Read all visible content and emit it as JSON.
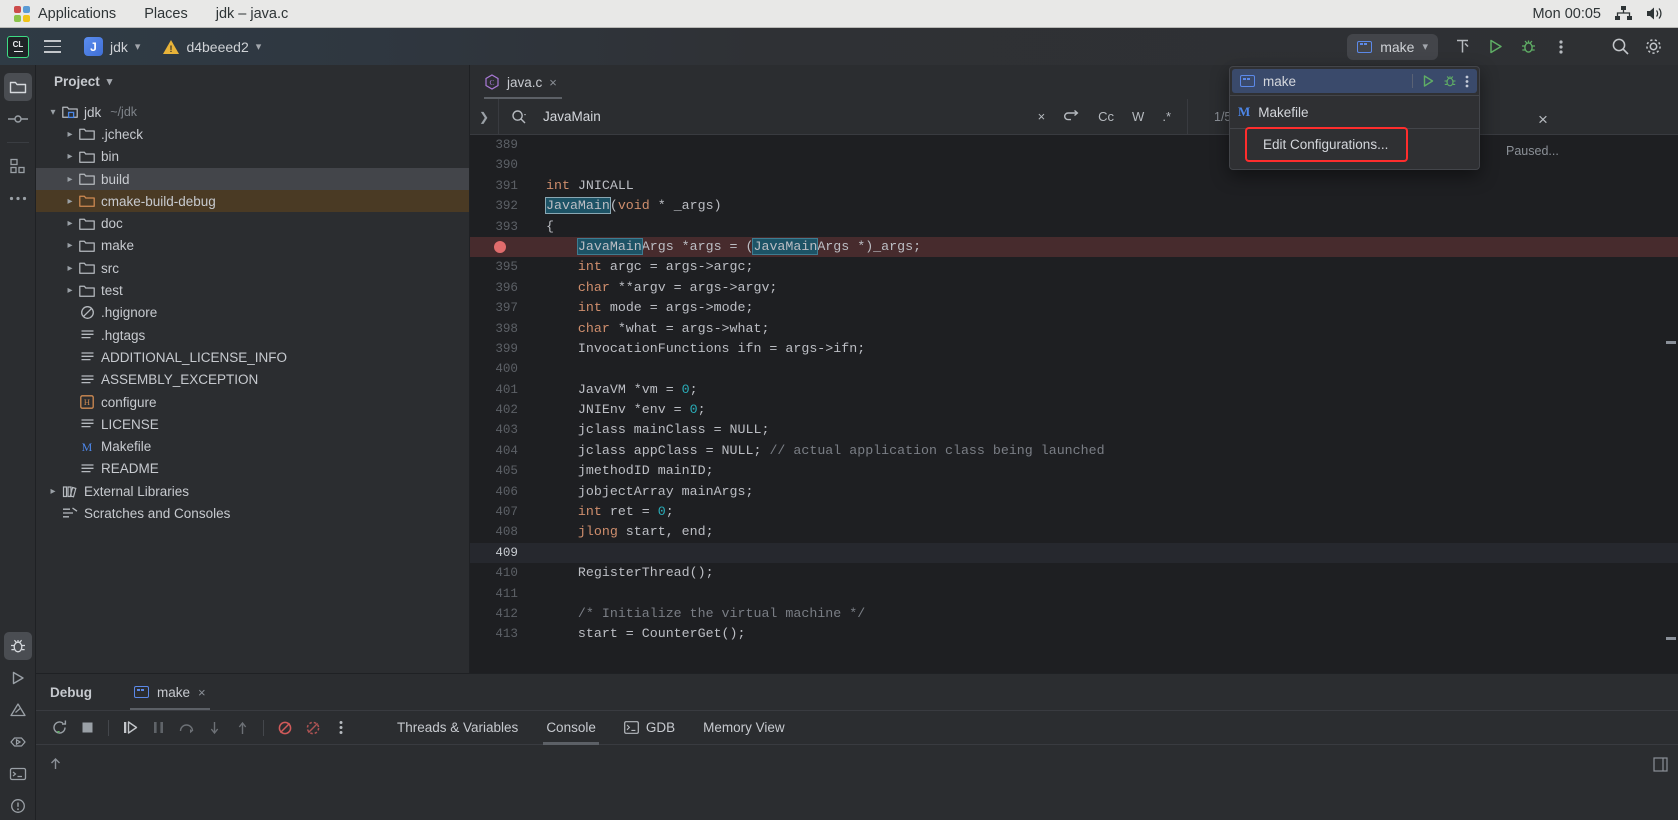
{
  "desktop": {
    "menu": [
      "Applications",
      "Places"
    ],
    "window_title": "jdk – java.c",
    "clock": "Mon 00:05",
    "tray": [
      "network-icon",
      "volume-icon"
    ]
  },
  "toolbar": {
    "app_badge": "CL",
    "menu_icon": "hamburger-icon",
    "project_name": "jdk",
    "project_initial": "J",
    "branch_name": "d4beeed2",
    "run_config": "make",
    "buttons": [
      "build-icon",
      "run-icon",
      "debug-icon",
      "more-icon"
    ],
    "search_icon": "search-icon",
    "settings_icon": "gear-icon"
  },
  "rail": {
    "top": [
      "project-folder-icon",
      "commit-icon",
      "structure-icon",
      "more-tool-windows-icon"
    ],
    "bottom": [
      "debug-icon",
      "run-icon",
      "problems-icon",
      "services-icon",
      "terminal-icon",
      "notifications-icon"
    ]
  },
  "project": {
    "title": "Project",
    "tree": [
      {
        "label": "jdk",
        "note": "~/jdk",
        "indent": 0,
        "twisty": "down",
        "icon": "project-folder-icon",
        "state": "none"
      },
      {
        "label": ".jcheck",
        "note": "",
        "indent": 1,
        "twisty": "right",
        "icon": "folder-icon",
        "state": "none"
      },
      {
        "label": "bin",
        "note": "",
        "indent": 1,
        "twisty": "right",
        "icon": "folder-icon",
        "state": "none"
      },
      {
        "label": "build",
        "note": "",
        "indent": 1,
        "twisty": "right",
        "icon": "folder-icon",
        "state": "selected"
      },
      {
        "label": "cmake-build-debug",
        "note": "",
        "indent": 1,
        "twisty": "right",
        "icon": "folder-orange-icon",
        "state": "highlight"
      },
      {
        "label": "doc",
        "note": "",
        "indent": 1,
        "twisty": "right",
        "icon": "folder-icon",
        "state": "none"
      },
      {
        "label": "make",
        "note": "",
        "indent": 1,
        "twisty": "right",
        "icon": "folder-icon",
        "state": "none"
      },
      {
        "label": "src",
        "note": "",
        "indent": 1,
        "twisty": "right",
        "icon": "folder-icon",
        "state": "none"
      },
      {
        "label": "test",
        "note": "",
        "indent": 1,
        "twisty": "right",
        "icon": "folder-icon",
        "state": "none"
      },
      {
        "label": ".hgignore",
        "note": "",
        "indent": 1,
        "twisty": "",
        "icon": "ignore-file-icon",
        "state": "none"
      },
      {
        "label": ".hgtags",
        "note": "",
        "indent": 1,
        "twisty": "",
        "icon": "text-file-icon",
        "state": "none"
      },
      {
        "label": "ADDITIONAL_LICENSE_INFO",
        "note": "",
        "indent": 1,
        "twisty": "",
        "icon": "text-file-icon",
        "state": "none"
      },
      {
        "label": "ASSEMBLY_EXCEPTION",
        "note": "",
        "indent": 1,
        "twisty": "",
        "icon": "text-file-icon",
        "state": "none"
      },
      {
        "label": "configure",
        "note": "",
        "indent": 1,
        "twisty": "",
        "icon": "shell-file-icon",
        "state": "none"
      },
      {
        "label": "LICENSE",
        "note": "",
        "indent": 1,
        "twisty": "",
        "icon": "text-file-icon",
        "state": "none"
      },
      {
        "label": "Makefile",
        "note": "",
        "indent": 1,
        "twisty": "",
        "icon": "makefile-icon",
        "state": "none"
      },
      {
        "label": "README",
        "note": "",
        "indent": 1,
        "twisty": "",
        "icon": "text-file-icon",
        "state": "none"
      },
      {
        "label": "External Libraries",
        "note": "",
        "indent": 0,
        "twisty": "right",
        "icon": "library-icon",
        "state": "none"
      },
      {
        "label": "Scratches and Consoles",
        "note": "",
        "indent": 0,
        "twisty": "",
        "icon": "scratches-icon",
        "state": "none"
      }
    ]
  },
  "editor": {
    "tab": {
      "label": "java.c",
      "icon": "c-file-icon",
      "close": "×"
    },
    "find": {
      "value": "JavaMain",
      "clear": "×",
      "toggles": [
        "regex-replace-icon",
        "Cc",
        "W",
        ".*"
      ],
      "count": "1/5",
      "prev": "↑",
      "next": "↓",
      "filter_icon": "filter-icon",
      "more_icon": "more-icon"
    },
    "lines": [
      {
        "n": "389",
        "text": "",
        "state": "normal"
      },
      {
        "n": "390",
        "text": "",
        "state": "normal"
      },
      {
        "n": "391",
        "text": "int JNICALL",
        "state": "normal"
      },
      {
        "n": "392",
        "text": "JavaMain(void * _args)",
        "state": "normal"
      },
      {
        "n": "393",
        "text": "{",
        "state": "normal"
      },
      {
        "n": "394",
        "text": "    JavaMainArgs *args = (JavaMainArgs *)_args;",
        "state": "breakpoint"
      },
      {
        "n": "395",
        "text": "    int argc = args->argc;",
        "state": "normal"
      },
      {
        "n": "396",
        "text": "    char **argv = args->argv;",
        "state": "normal"
      },
      {
        "n": "397",
        "text": "    int mode = args->mode;",
        "state": "normal"
      },
      {
        "n": "398",
        "text": "    char *what = args->what;",
        "state": "normal"
      },
      {
        "n": "399",
        "text": "    InvocationFunctions ifn = args->ifn;",
        "state": "normal"
      },
      {
        "n": "400",
        "text": "",
        "state": "normal"
      },
      {
        "n": "401",
        "text": "    JavaVM *vm = 0;",
        "state": "normal"
      },
      {
        "n": "402",
        "text": "    JNIEnv *env = 0;",
        "state": "normal"
      },
      {
        "n": "403",
        "text": "    jclass mainClass = NULL;",
        "state": "normal"
      },
      {
        "n": "404",
        "text": "    jclass appClass = NULL; // actual application class being launched",
        "state": "normal"
      },
      {
        "n": "405",
        "text": "    jmethodID mainID;",
        "state": "normal"
      },
      {
        "n": "406",
        "text": "    jobjectArray mainArgs;",
        "state": "normal"
      },
      {
        "n": "407",
        "text": "    int ret = 0;",
        "state": "normal"
      },
      {
        "n": "408",
        "text": "    jlong start, end;",
        "state": "normal"
      },
      {
        "n": "409",
        "text": "",
        "state": "caret"
      },
      {
        "n": "410",
        "text": "    RegisterThread();",
        "state": "normal"
      },
      {
        "n": "411",
        "text": "",
        "state": "normal"
      },
      {
        "n": "412",
        "text": "    /* Initialize the virtual machine */",
        "state": "normal"
      },
      {
        "n": "413",
        "text": "    start = CounterGet();",
        "state": "normal"
      }
    ]
  },
  "run_popup": {
    "items": [
      {
        "label": "make",
        "icon": "run-config-icon",
        "selected": true
      },
      {
        "label": "Makefile",
        "icon": "makefile-icon",
        "selected": false
      }
    ],
    "selected_actions": [
      "run-icon",
      "settings-icon",
      "more-icon"
    ],
    "edit_configurations": "Edit Configurations...",
    "close": "×",
    "paused_label": "Paused..."
  },
  "debug": {
    "title": "Debug",
    "session_tab": {
      "label": "make",
      "icon": "run-config-icon",
      "close": "×"
    },
    "toolbar": [
      "rerun-icon",
      "stop-icon",
      "resume-icon",
      "pause-icon",
      "step-over-icon",
      "step-into-icon",
      "step-out-icon",
      "mute-breakpoints-icon",
      "view-breakpoints-icon",
      "more-icon"
    ],
    "tabs": [
      {
        "label": "Threads & Variables",
        "icon": "",
        "active": false
      },
      {
        "label": "Console",
        "icon": "",
        "active": true
      },
      {
        "label": "GDB",
        "icon": "gdb-icon",
        "active": false
      },
      {
        "label": "Memory View",
        "icon": "",
        "active": false
      }
    ],
    "console_prompt": "prompt-icon"
  },
  "colors": {
    "accent": "#5c89e8",
    "breakpoint": "#e06c6c",
    "run_green": "#5fad65",
    "highlight_red": "#ff2d2d",
    "search_match": "#1d5366",
    "editor_bg": "#1e1f22",
    "panel_bg": "#2b2d30"
  }
}
